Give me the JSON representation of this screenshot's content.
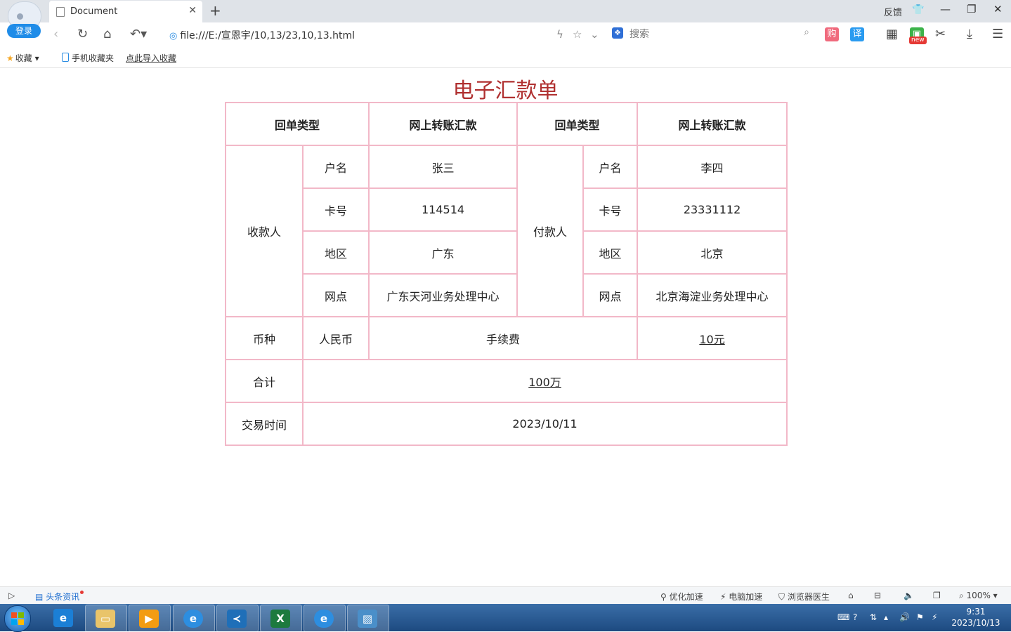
{
  "browser": {
    "login_label": "登录",
    "tab_title": "Document",
    "feedback_label": "反馈",
    "url": "file:///E:/宣恩宇/10,13/23,10,13.html",
    "search_placeholder": "搜索",
    "shop_label": "购",
    "translate_label": "译",
    "new_badge": "new"
  },
  "bookmarks": {
    "favorites_label": "收藏",
    "mobile_favorites_label": "手机收藏夹",
    "import_label": "点此导入收藏"
  },
  "page": {
    "title": "电子汇款单",
    "table": {
      "receipt_type_label_left": "回单类型",
      "receipt_type_value_left": "网上转账汇款",
      "receipt_type_label_right": "回单类型",
      "receipt_type_value_right": "网上转账汇款",
      "payee_label": "收款人",
      "payer_label": "付款人",
      "payee": {
        "name_label": "户名",
        "name": "张三",
        "card_label": "卡号",
        "card": "114514",
        "region_label": "地区",
        "region": "广东",
        "branch_label": "网点",
        "branch": "广东天河业务处理中心"
      },
      "payer": {
        "name_label": "户名",
        "name": "李四",
        "card_label": "卡号",
        "card": "23331112",
        "region_label": "地区",
        "region": "北京",
        "branch_label": "网点",
        "branch": "北京海淀业务处理中心"
      },
      "currency_label": "币种",
      "currency": "人民币",
      "fee_label": "手续费",
      "fee": "10元",
      "total_label": "合计",
      "total": "100万",
      "time_label": "交易时间",
      "time": "2023/10/11"
    }
  },
  "statusbar": {
    "news_label": "头条资讯",
    "optimize_label": "优化加速",
    "pc_speed_label": "电脑加速",
    "doctor_label": "浏览器医生",
    "zoom": "100%"
  },
  "taskbar": {
    "time": "9:31",
    "date": "2023/10/13"
  },
  "colors": {
    "title_red": "#b03030",
    "table_border": "#f2b8c8",
    "accent_blue": "#1f8ce8"
  }
}
